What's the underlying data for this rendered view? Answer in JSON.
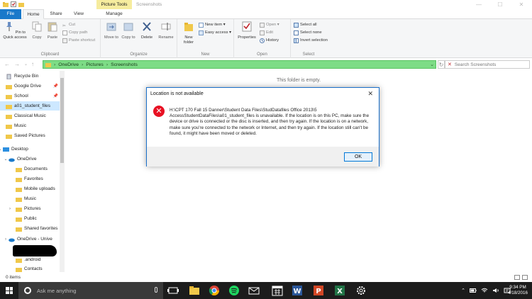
{
  "window": {
    "title": "Screenshots",
    "context_tab_group": "Picture Tools",
    "minimize": "—",
    "maximize": "☐",
    "close": "✕"
  },
  "ribbon_tabs": [
    "File",
    "Home",
    "Share",
    "View",
    "Manage"
  ],
  "ribbon": {
    "clipboard": {
      "label": "Clipboard",
      "pin": "Pin to Quick access",
      "copy": "Copy",
      "paste": "Paste",
      "cut": "Cut",
      "copy_path": "Copy path",
      "paste_shortcut": "Paste shortcut"
    },
    "organize": {
      "label": "Organize",
      "move_to": "Move to",
      "copy_to": "Copy to",
      "delete": "Delete",
      "rename": "Rename"
    },
    "new": {
      "label": "New",
      "new_folder": "New folder",
      "new_item": "New item ▾",
      "easy_access": "Easy access ▾"
    },
    "open": {
      "label": "Open",
      "properties": "Properties",
      "open": "Open ▾",
      "edit": "Edit",
      "history": "History"
    },
    "select": {
      "label": "Select",
      "select_all": "Select all",
      "select_none": "Select none",
      "invert": "Invert selection"
    }
  },
  "address": {
    "crumbs": [
      "OneDrive",
      "Pictures",
      "Screenshots"
    ],
    "search_placeholder": "Search Screenshots"
  },
  "nav": {
    "items": [
      {
        "label": "Recycle Bin"
      },
      {
        "label": "Google Drive"
      },
      {
        "label": "School"
      },
      {
        "label": "a01_student_files"
      },
      {
        "label": "Classical Music"
      },
      {
        "label": "Music"
      },
      {
        "label": "Saved Pictures"
      },
      {
        "label": "Desktop"
      },
      {
        "label": "OneDrive"
      },
      {
        "label": "Documents"
      },
      {
        "label": "Favorites"
      },
      {
        "label": "Mobile uploads"
      },
      {
        "label": "Music"
      },
      {
        "label": "Pictures"
      },
      {
        "label": "Public"
      },
      {
        "label": "Shared favorites"
      },
      {
        "label": "OneDrive - Unive"
      },
      {
        "label": ".android"
      },
      {
        "label": "Contacts"
      }
    ]
  },
  "main": {
    "empty_text": "This folder is empty."
  },
  "status": {
    "items": "0 items"
  },
  "dialog": {
    "title": "Location is not available",
    "message": "H:\\CPT 170 Fall 15 Danner\\Student Data Files\\StudDatafiles Office 2013\\5 AccessStudentDataFiles\\a01_student_files is unavailable. If the location is on this PC, make sure the device or drive is connected or the disc is inserted, and then try again. If the location is on a network, make sure you're connected to the network or Internet, and then try again. If the location still can't be found, it might have been moved or deleted.",
    "ok": "OK",
    "close": "✕"
  },
  "taskbar": {
    "search_placeholder": "Ask me anything",
    "time": "9:34 PM",
    "date": "4/18/2016"
  },
  "colors": {
    "accent": "#1979ca",
    "address_highlight": "#7ddc86",
    "error": "#e81123",
    "taskbar": "#1c1c1c"
  }
}
